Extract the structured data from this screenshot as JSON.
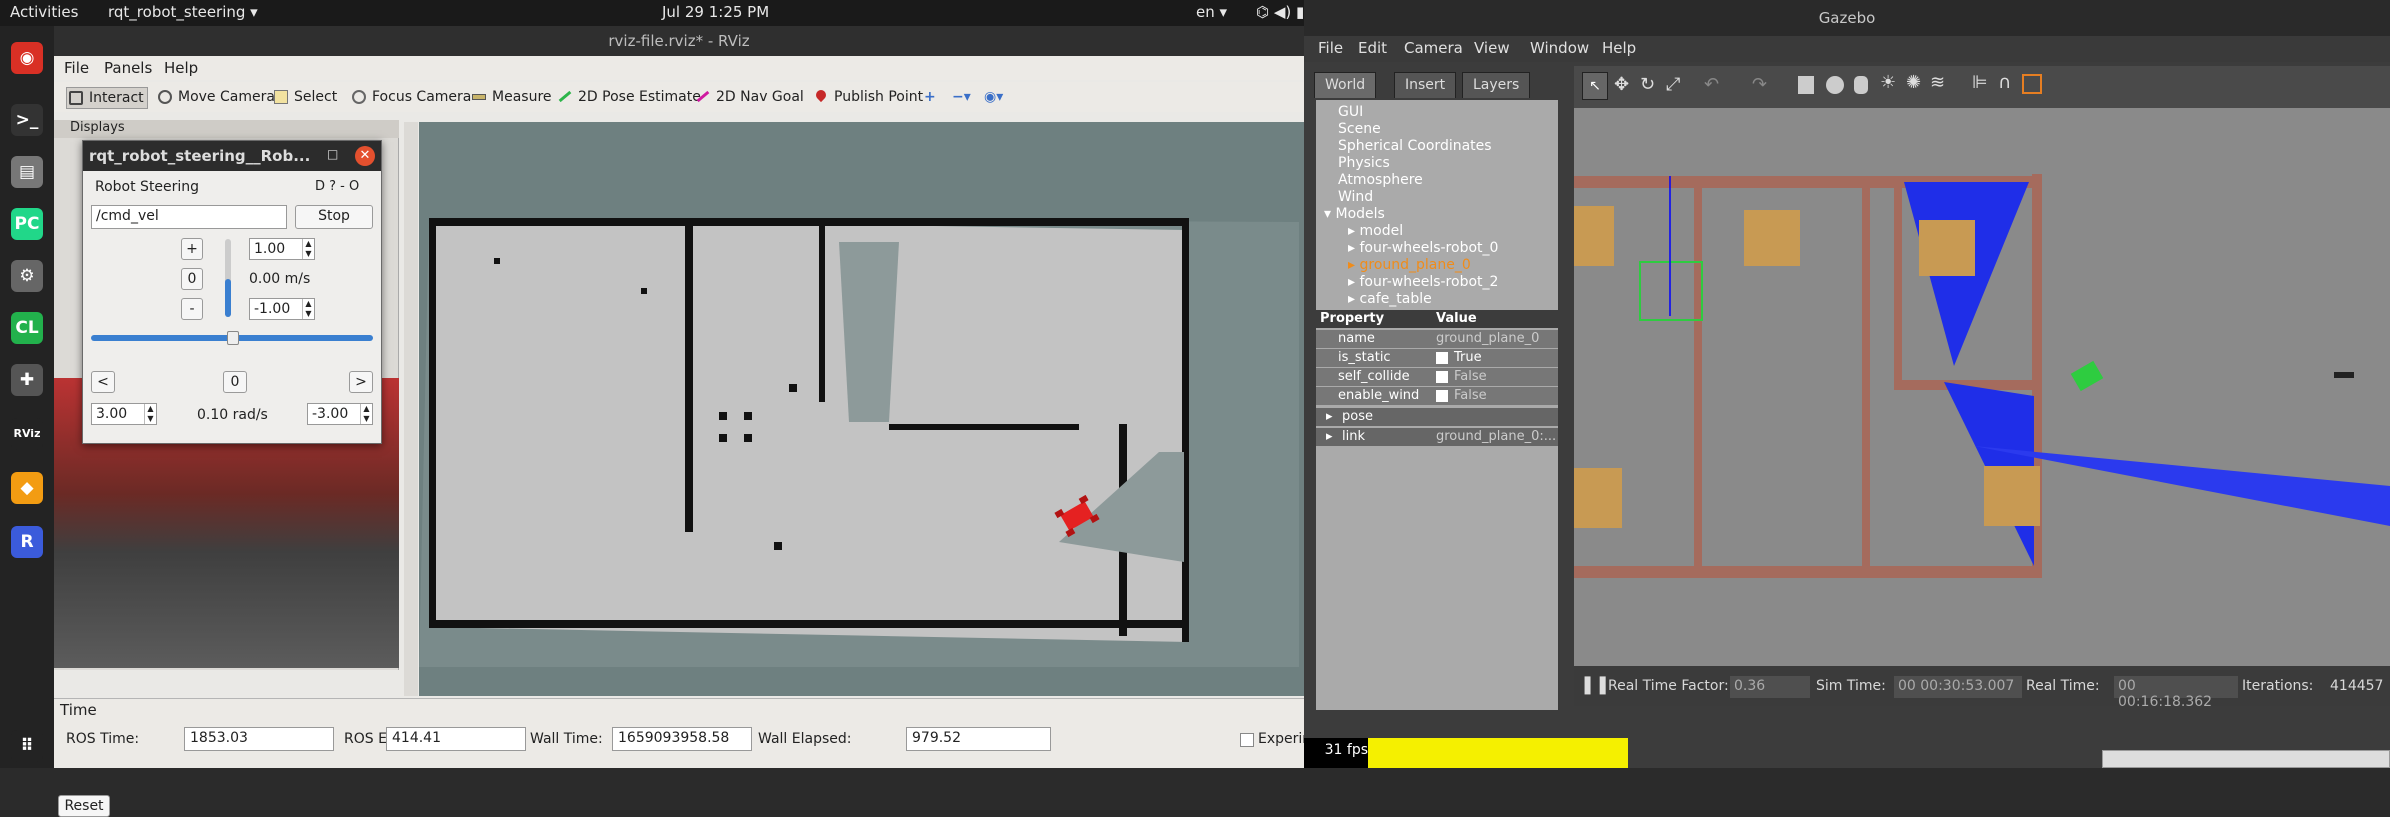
{
  "topbar": {
    "activities": "Activities",
    "app": "rqt_robot_steering ▾",
    "datetime": "Jul 29  1:25 PM",
    "lang": "en ▾",
    "tray": "⌬ ◀) ▮▾"
  },
  "dock": [
    {
      "name": "chrome-icon",
      "glyph": "◉",
      "color": "#d93025"
    },
    {
      "name": "terminal-icon",
      "glyph": ">_",
      "color": "#333"
    },
    {
      "name": "files-icon",
      "glyph": "▤",
      "color": "#777"
    },
    {
      "name": "pycharm-icon",
      "glyph": "PC",
      "color": "#21d789"
    },
    {
      "name": "settings-icon",
      "glyph": "⚙",
      "color": "#666"
    },
    {
      "name": "clion-icon",
      "glyph": "CL",
      "color": "#22b14c"
    },
    {
      "name": "gamepad-icon",
      "glyph": "✚",
      "color": "#555"
    },
    {
      "name": "rviz-icon",
      "glyph": "RViz",
      "color": "#232323"
    },
    {
      "name": "layers-icon",
      "glyph": "◆",
      "color": "#f39c12"
    },
    {
      "name": "r-icon",
      "glyph": "R",
      "color": "#3b5bdb"
    },
    {
      "name": "apps-grid-icon",
      "glyph": "⠿",
      "color": "#232323"
    }
  ],
  "rviz": {
    "title": "rviz-file.rviz* - RViz",
    "menu": [
      "File",
      "Panels",
      "Help"
    ],
    "tools": [
      "Interact",
      "Move Camera",
      "Select",
      "Focus Camera",
      "Measure",
      "2D Pose Estimate",
      "2D Nav Goal",
      "Publish Point"
    ],
    "displays_label": "Displays",
    "time": {
      "title": "Time",
      "ros_time_label": "ROS Time:",
      "ros_time": "1853.03",
      "ros_elapsed_label": "ROS Elapsed:",
      "ros_elapsed": "414.41",
      "wall_time_label": "Wall Time:",
      "wall_time": "1659093958.58",
      "wall_elapsed_label": "Wall Elapsed:",
      "wall_elapsed": "979.52",
      "experimental": "Experim",
      "reset": "Reset"
    },
    "fps": "31 fps"
  },
  "steering": {
    "window_title": "rqt_robot_steering__Rob...",
    "plugin_title": "Robot Steering",
    "topic": "/cmd_vel",
    "stop": "Stop",
    "plus": "+",
    "zero": "0",
    "minus": "-",
    "max_lin": "1.00",
    "min_lin": "-1.00",
    "lin_value": "0.00 m/s",
    "left": "<",
    "right": ">",
    "ang_zero": "0",
    "max_ang": "3.00",
    "min_ang": "-3.00",
    "ang_value": "0.10 rad/s",
    "help": "D ? - O"
  },
  "gazebo": {
    "title": "Gazebo",
    "menu": [
      "File",
      "Edit",
      "Camera",
      "View",
      "Window",
      "Help"
    ],
    "tabs": [
      "World",
      "Insert",
      "Layers"
    ],
    "tree": [
      "GUI",
      "Scene",
      "Spherical Coordinates",
      "Physics",
      "Atmosphere",
      "Wind",
      "Models",
      "model",
      "four-wheels-robot_0",
      "ground_plane_0",
      "four-wheels-robot_2",
      "cafe_table"
    ],
    "props_header": [
      "Property",
      "Value"
    ],
    "props": [
      {
        "k": "name",
        "v": "ground_plane_0"
      },
      {
        "k": "is_static",
        "v": "True"
      },
      {
        "k": "self_collide",
        "v": "False"
      },
      {
        "k": "enable_wind",
        "v": "False"
      },
      {
        "k": "pose",
        "v": ""
      },
      {
        "k": "link",
        "v": "ground_plane_0:..."
      }
    ],
    "status": {
      "rtf_label": "Real Time Factor:",
      "rtf": "0.36",
      "sim_label": "Sim Time:",
      "sim": "00 00:30:53.007",
      "real_label": "Real Time:",
      "real": "00 00:16:18.362",
      "iter_label": "Iterations:",
      "iter": "414457"
    }
  }
}
